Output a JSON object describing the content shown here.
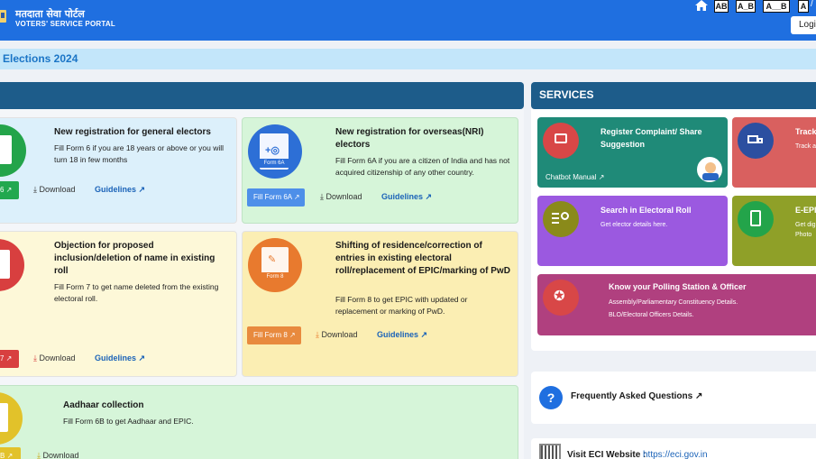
{
  "header": {
    "brand_hindi": "मतदाता सेवा पोर्टल",
    "brand_english": "VOTERS' SERVICE PORTAL",
    "text_size_buttons": [
      "AB",
      "A_B",
      "A__B",
      "A"
    ],
    "slash": "/",
    "login_label": "Login"
  },
  "banner": {
    "text": "Elections 2024"
  },
  "forms": [
    {
      "title": "New registration for general electors",
      "desc": "Fill Form 6 if you are 18 years or above or you will turn 18 in few months",
      "fill_label": "6",
      "download": "Download",
      "guidelines": "Guidelines"
    },
    {
      "title": "New registration for overseas(NRI) electors",
      "desc": "Fill Form 6A if you are a citizen of India and has not acquired citizenship of any other country.",
      "fill_label": "Fill Form 6A",
      "icon_label": "Form 6A",
      "download": "Download",
      "guidelines": "Guidelines"
    },
    {
      "title": "Objection for proposed inclusion/deletion of name in existing roll",
      "desc": "Fill Form 7 to get name deleted from the existing electoral roll.",
      "fill_label": "7",
      "download": "Download",
      "guidelines": "Guidelines"
    },
    {
      "title": "Shifting of residence/correction of entries in existing electoral roll/replacement of EPIC/marking of PwD",
      "desc": "Fill Form 8 to get EPIC with updated or replacement or marking of PwD.",
      "fill_label": "Fill Form 8",
      "icon_label": "Form 8",
      "download": "Download",
      "guidelines": "Guidelines"
    },
    {
      "title": "Aadhaar collection",
      "desc": "Fill Form 6B to get Aadhaar and EPIC.",
      "fill_label": "B",
      "download": "Download"
    }
  ],
  "services": {
    "heading": "SERVICES",
    "items": [
      {
        "title": "Register Complaint/ Share Suggestion",
        "sub": "Chatbot Manual",
        "color": "#1f8a78"
      },
      {
        "title": "Track",
        "desc": "Track a",
        "color": "#d9605f"
      },
      {
        "title": "Search in Electoral Roll",
        "desc": "Get elector details here.",
        "color": "#9b59e0"
      },
      {
        "title": "E-EPIC",
        "desc": "Get dig Photo",
        "color": "#8fa028"
      },
      {
        "title": "Know your Polling Station & Officer",
        "desc": "Assembly/Parliamentary Constituency Details. BLO/Electoral Officers Details.",
        "color": "#b0407f"
      }
    ]
  },
  "faq": {
    "label": "Frequently Asked Questions"
  },
  "eci": {
    "label": "Visit ECI Website :",
    "link": "https://eci.gov.in"
  }
}
